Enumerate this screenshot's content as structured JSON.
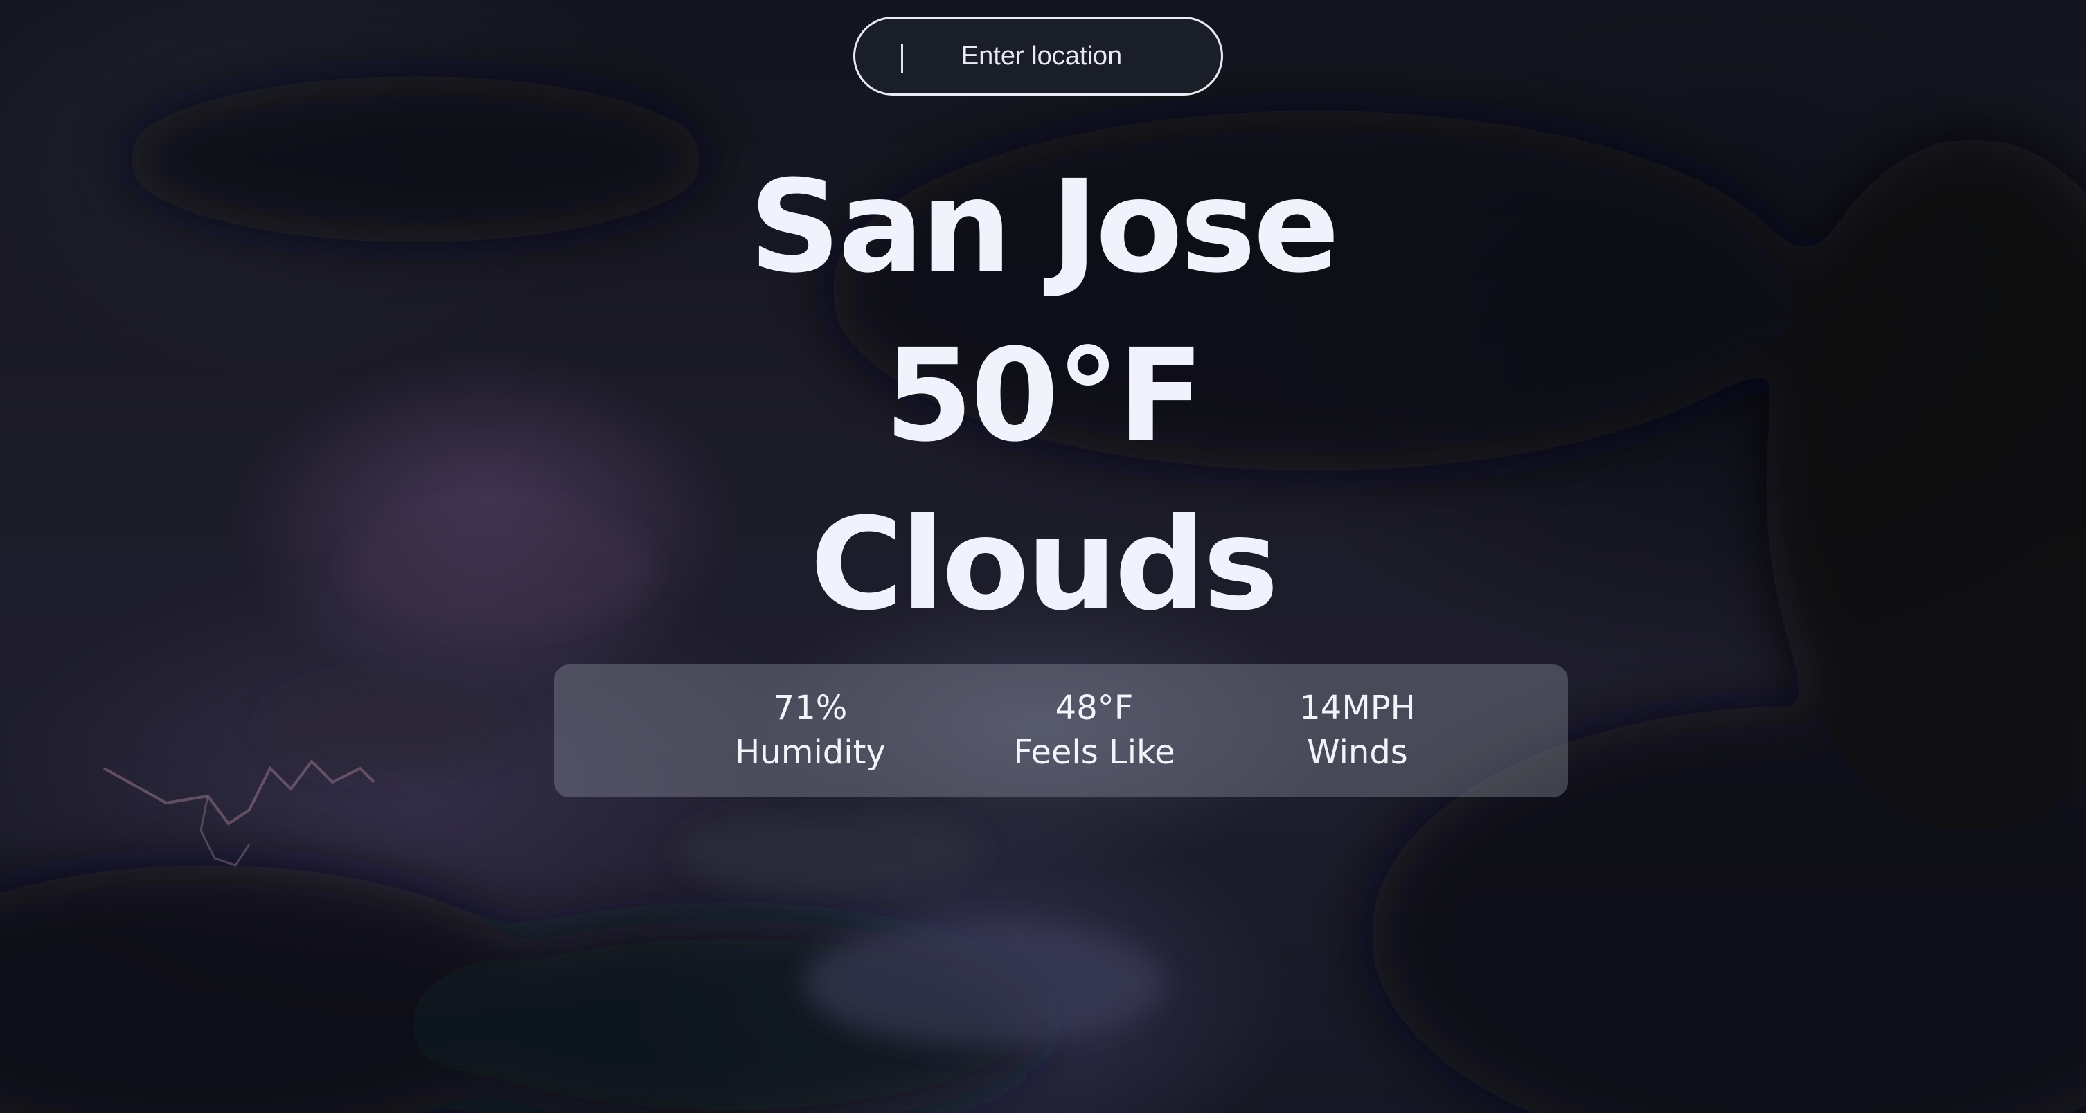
{
  "search": {
    "placeholder": "Enter location"
  },
  "weather": {
    "city": "San Jose",
    "temperature": "50°F",
    "condition": "Clouds"
  },
  "stats": {
    "humidity_value": "71%",
    "humidity_label": "Humidity",
    "feels_like_value": "48°F",
    "feels_like_label": "Feels Like",
    "winds_value": "14MPH",
    "winds_label": "Winds"
  },
  "colors": {
    "text": "#f0f3fc",
    "panel": "#969baa",
    "search_border": "#e9ecf4",
    "background": "#1c1b28"
  }
}
